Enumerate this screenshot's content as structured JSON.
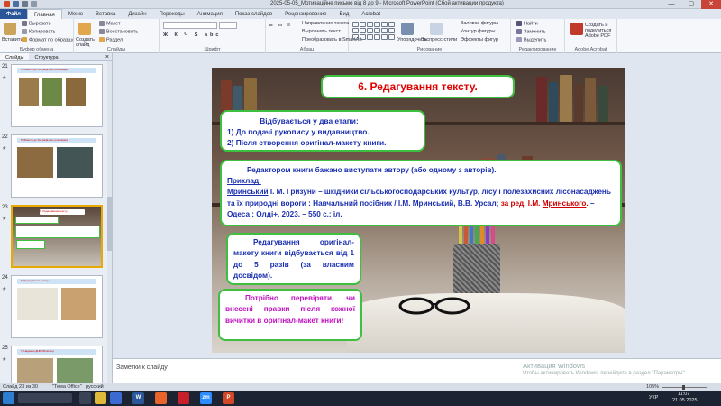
{
  "window": {
    "title": "2025-05-05_Мотиваційне письмо від 8 до 9 - Microsoft PowerPoint (Сбой активации продукта)",
    "minimize": "—",
    "maximize": "▢",
    "close": "✕"
  },
  "ribbon": {
    "tabs": [
      "Файл",
      "Главная",
      "Меню",
      "Вставка",
      "Дизайн",
      "Переходы",
      "Анимация",
      "Показ слайдов",
      "Рецензирование",
      "Вид",
      "Acrobat"
    ],
    "groups": {
      "clipboard": {
        "label": "Буфер обмена",
        "paste": "Вставить",
        "cut": "Вырезать",
        "copy": "Копировать",
        "format": "Формат по образцу"
      },
      "slides": {
        "label": "Слайды",
        "create": "Создать слайд",
        "layout": "Макет",
        "reset": "Восстановить",
        "section": "Раздел"
      },
      "font": {
        "label": "Шрифт"
      },
      "paragraph": {
        "label": "Абзац",
        "direction": "Направление текста",
        "align": "Выровнять текст",
        "smartart": "Преобразовать в SmartArt"
      },
      "drawing": {
        "label": "Рисование",
        "arrange": "Упорядочить",
        "styles": "Экспресс-стили",
        "fill": "Заливка фигуры",
        "outline": "Контур фигуры",
        "effects": "Эффекты фигур"
      },
      "editing": {
        "label": "Редактирование",
        "find": "Найти",
        "replace": "Заменить",
        "select": "Выделить"
      },
      "acrobat": {
        "label": "Adobe Acrobat",
        "share": "Создать и поделиться Adobe PDF"
      }
    }
  },
  "left_panel": {
    "tabs": [
      "Слайды",
      "Структура"
    ],
    "close": "×",
    "thumbnails": [
      {
        "number": "21",
        "title": "1. Вимоги до біографічних розповідей"
      },
      {
        "number": "22",
        "title": "5. Вимоги до біографічних розповідей"
      },
      {
        "number": "23",
        "title": "6. Редагування тексту."
      },
      {
        "number": "24",
        "title": "6. Редагування тексту."
      },
      {
        "number": "25",
        "title": "7. Надання ДНК бібліотеці."
      }
    ]
  },
  "slide": {
    "title": "6. Редагування тексту.",
    "box1": {
      "heading": "Відбувається у два етапи:",
      "items": [
        "1)   До подачі рукопису у видавництво.",
        "2)   Після створення оригінал-макету книги."
      ]
    },
    "box2": {
      "line1": "Редактором книги бажано виступати автору (або одному з авторів).",
      "example_label": "Приклад:",
      "ref_author": "Мринський",
      "ref_text": " І. М. Гризуни – шкідники сільськогосподарських культур, лісу і полезахисних лісонасаджень та їх природні вороги : Навчальний посібник / І.М. Мринський, В.В. Урсал;",
      "ref_editor_prefix": "за ред. І.М. ",
      "ref_editor_name": "Мринського",
      "ref_editor_suffix": ".",
      "ref_publisher": " – Одеса : Олді+, 2023. – 550 с.: іл."
    },
    "box3": "Редагування оригінал-макету книги відбувається від 1 до 5 разів (за власним досвідом).",
    "box4": "Потрібно перевіряти, чи внесені правки після кожної вичитки в оригінал-макет книги!"
  },
  "notes": {
    "placeholder": "Заметки к слайду",
    "watermark_title": "Активация Windows",
    "watermark_text": "Чтобы активировать Windows, перейдите в раздел \"Параметры\"."
  },
  "status": {
    "slide_info": "Слайд 23 из 30",
    "theme": "\"Тема Office\"",
    "language": "русский",
    "zoom": "105%"
  },
  "taskbar": {
    "language": "УКР",
    "time": "11:07",
    "date": "21.05.2025"
  },
  "colors": {
    "title_red": "#e00000",
    "body_blue": "#1a2fb0",
    "magenta": "#c010c0",
    "green_border": "#3fbf3f",
    "file_tab": "#2a5699"
  }
}
